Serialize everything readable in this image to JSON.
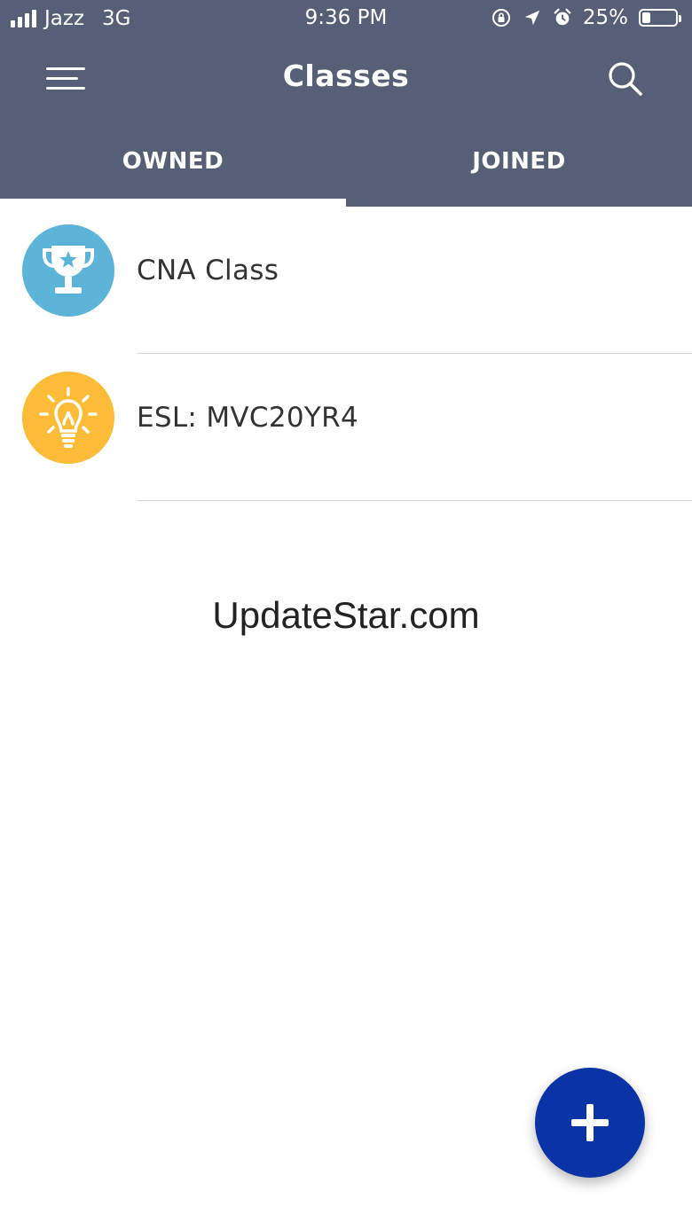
{
  "status_bar": {
    "carrier": "Jazz",
    "network": "3G",
    "time": "9:36 PM",
    "battery": "25%",
    "battery_level": 0.25
  },
  "app_bar": {
    "title": "Classes",
    "background_color": "#565f76",
    "menu_icon": "hamburger-menu-icon",
    "search_icon": "search-icon"
  },
  "tabs": [
    {
      "label": "OWNED",
      "selected": true
    },
    {
      "label": "JOINED",
      "selected": false
    }
  ],
  "classes": [
    {
      "name": "CNA Class",
      "icon": "trophy-icon",
      "color": "#5db4d9"
    },
    {
      "name": "ESL: MVC20YR4",
      "icon": "lightbulb-icon",
      "color": "#fcbc37"
    }
  ],
  "watermark": "UpdateStar.com",
  "fab": {
    "icon": "plus-icon",
    "color": "#0a34a6"
  }
}
